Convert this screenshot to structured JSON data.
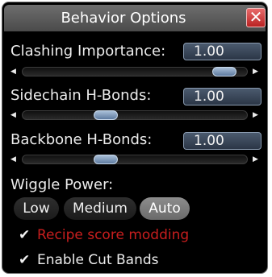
{
  "window": {
    "title": "Behavior Options",
    "close_glyph": "✕",
    "close_icon": "close-icon"
  },
  "sliders": [
    {
      "label": "Clashing Importance:",
      "value": "1.00",
      "position": 0.9
    },
    {
      "label": "Sidechain H-Bonds:",
      "value": "1.00",
      "position": 0.37
    },
    {
      "label": "Backbone H-Bonds:",
      "value": "1.00",
      "position": 0.37
    }
  ],
  "arrows": {
    "left": "◀",
    "right": "▶"
  },
  "wiggle": {
    "label": "Wiggle Power:",
    "options": [
      "Low",
      "Medium",
      "Auto"
    ],
    "selected": "Auto"
  },
  "checkboxes": [
    {
      "label": "Recipe score modding",
      "checked": true,
      "color": "#c81e1e"
    },
    {
      "label": "Enable Cut Bands",
      "checked": true,
      "color": "#ececec"
    }
  ],
  "check_glyph": "✔"
}
